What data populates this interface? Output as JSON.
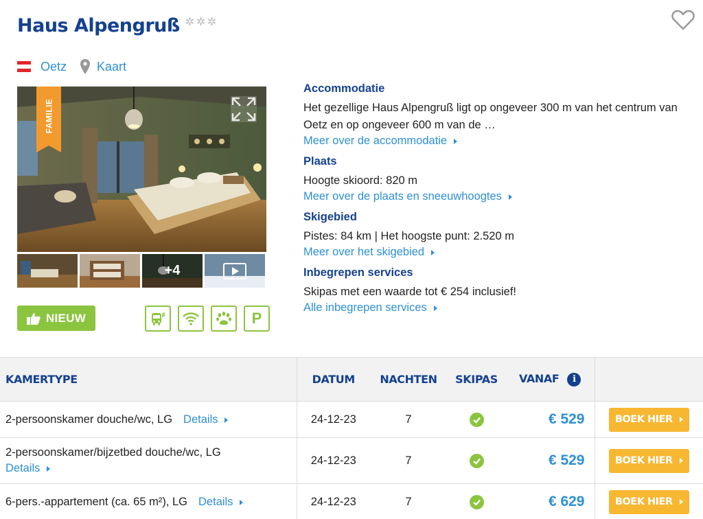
{
  "hotel": {
    "name": "Haus Alpengruß",
    "stars": 3,
    "location": "Oetz",
    "map_label": "Kaart",
    "ribbon_label": "FAMILIE",
    "thumbs_more": "+4",
    "new_label": "NIEUW"
  },
  "facilities": [
    "shuttle-bus-icon",
    "wifi-icon",
    "pets-allowed-icon",
    "parking-icon"
  ],
  "facility_parking_letter": "P",
  "info": {
    "accommodation": {
      "heading": "Accommodatie",
      "text": "Het gezellige Haus Alpengruß ligt op ongeveer 300 m van het centrum van Oetz en op ongeveer 600 m van de …",
      "link": "Meer over de accommodatie"
    },
    "place": {
      "heading": "Plaats",
      "text": "Hoogte skioord: 820 m",
      "link": "Meer over de plaats en sneeuwhoogtes"
    },
    "ski": {
      "heading": "Skigebied",
      "text": "Pistes: 84 km | Het hoogste punt: 2.520 m",
      "link": "Meer over het skigebied"
    },
    "services": {
      "heading": "Inbegrepen services",
      "text": "Skipas met een waarde tot € 254 inclusief!",
      "link": "Alle inbegrepen services"
    }
  },
  "table": {
    "headers": {
      "type": "KAMERTYPE",
      "date": "DATUM",
      "nights": "NACHTEN",
      "skipass": "SKIPAS",
      "from": "VANAF"
    },
    "details_label": "Details",
    "book_label": "BOEK HIER",
    "rows": [
      {
        "type": "2-persoonskamer douche/wc, LG",
        "date": "24-12-23",
        "nights": "7",
        "skipass": true,
        "price": "€ 529"
      },
      {
        "type": "2-persoonskamer/bijzetbed douche/wc, LG",
        "date": "24-12-23",
        "nights": "7",
        "skipass": true,
        "price": "€ 529"
      },
      {
        "type": "6-pers.-appartement (ca. 65 m²), LG",
        "date": "24-12-23",
        "nights": "7",
        "skipass": true,
        "price": "€ 629"
      }
    ]
  },
  "colors": {
    "brand_blue": "#14418f",
    "link_blue": "#2d8fd5",
    "green": "#8bc53f",
    "orange": "#f7b731",
    "ribbon": "#f39a2e"
  }
}
